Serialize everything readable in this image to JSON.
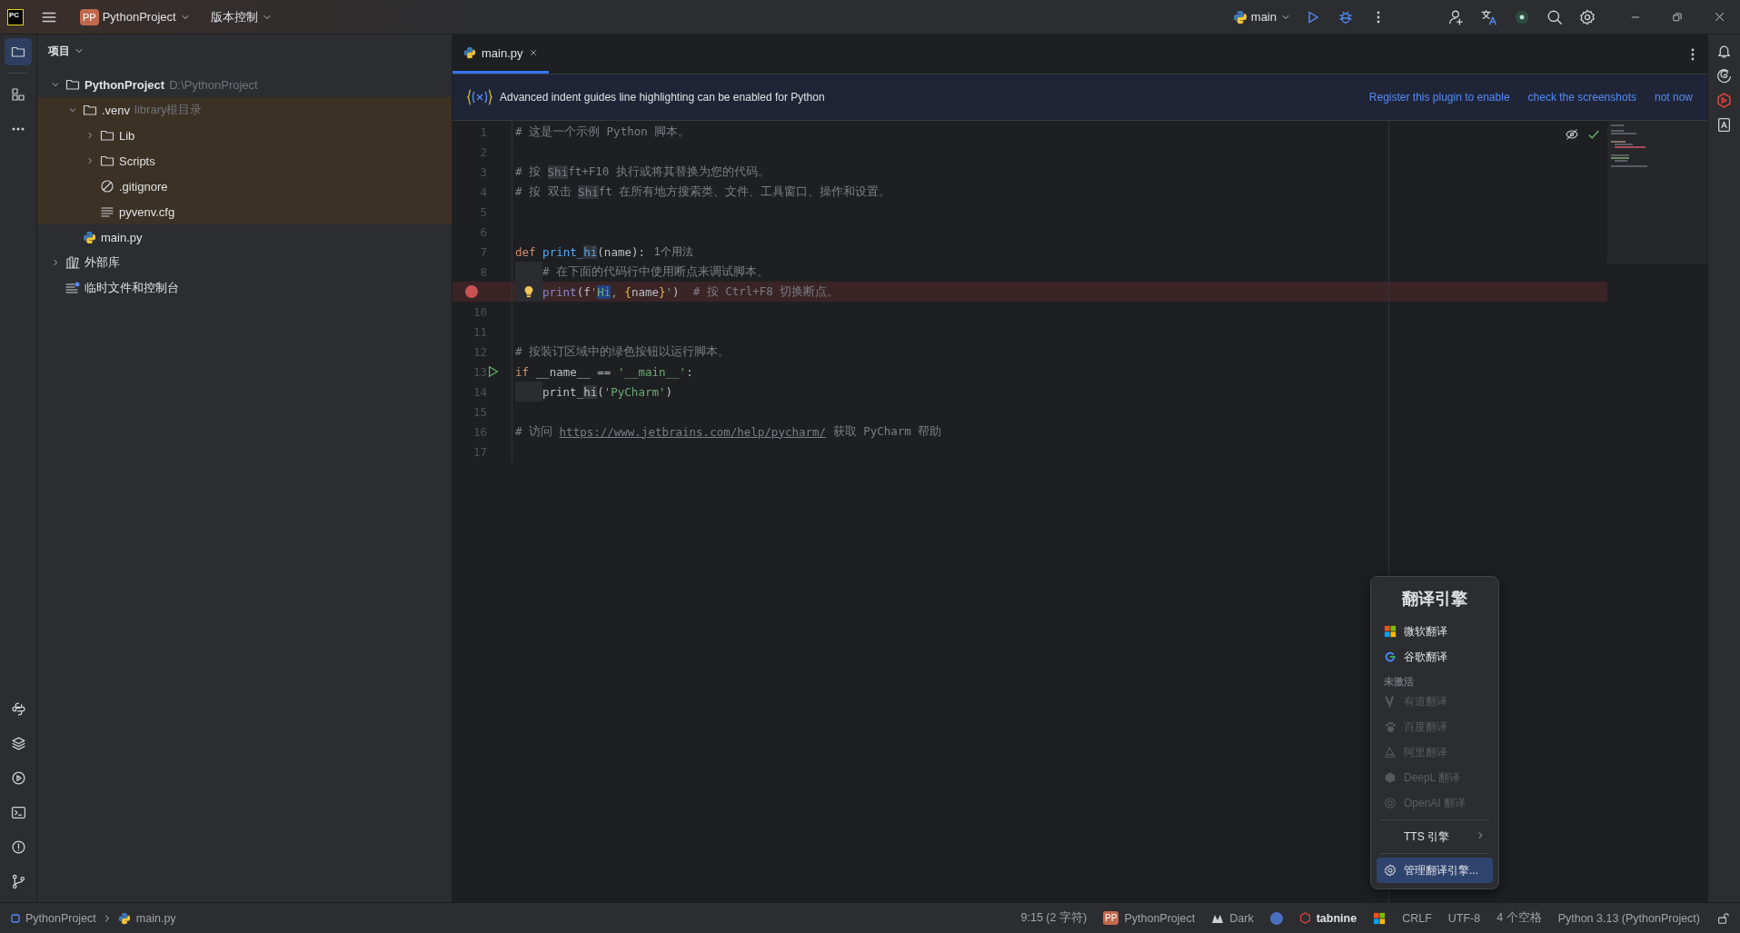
{
  "title_bar": {
    "logo": "PC",
    "project_badge": "PP",
    "project": "PythonProject",
    "vcs": "版本控制",
    "run_config": "main"
  },
  "tool_windows": [
    {
      "selected": true
    },
    {
      "selected": false
    }
  ],
  "project_panel": {
    "title": "项目",
    "tree": [
      {
        "name": "PythonProject",
        "note": "D:\\PythonProject",
        "kind": "folder",
        "bold": true,
        "expanded": true,
        "excluded": false,
        "children": [
          {
            "name": ".venv",
            "note": "library根目录",
            "kind": "folder",
            "bold": false,
            "expanded": true,
            "excluded": true,
            "children": [
              {
                "name": "Lib",
                "kind": "folder",
                "bold": false,
                "expanded": false
              },
              {
                "name": "Scripts",
                "kind": "folder",
                "bold": false,
                "expanded": false
              },
              {
                "name": ".gitignore",
                "kind": "ignore-file",
                "bold": false
              },
              {
                "name": "pyvenv.cfg",
                "kind": "text-file",
                "bold": false
              }
            ]
          },
          {
            "name": "main.py",
            "kind": "python-file",
            "bold": false,
            "excluded": false
          }
        ]
      },
      {
        "name": "外部库",
        "kind": "library",
        "bold": false,
        "expanded": false,
        "excluded": false
      },
      {
        "name": "临时文件和控制台",
        "kind": "scratches",
        "bold": false,
        "excluded": false
      }
    ]
  },
  "editor": {
    "tabs": [
      {
        "label": "main.py",
        "selected": true
      }
    ],
    "banner": {
      "text": "Advanced indent guides line highlighting can be enabled for Python",
      "links": [
        "Register this plugin to enable",
        "check the screenshots",
        "not now"
      ]
    },
    "lines": [
      {
        "number": "1",
        "tokens": [
          {
            "kind": "comment",
            "text": "# 这是一个示例 Python 脚本。"
          }
        ]
      },
      {
        "number": "2"
      },
      {
        "number": "3",
        "tokens": [
          {
            "kind": "comment",
            "text": "# 按 "
          },
          {
            "kind": "comment-match",
            "text": "Shi"
          },
          {
            "kind": "comment",
            "text": "ft+F10 执行或将其替换为您的代码。"
          }
        ]
      },
      {
        "number": "4",
        "tokens": [
          {
            "kind": "comment",
            "text": "# 按 双击 "
          },
          {
            "kind": "comment-match",
            "text": "Shi"
          },
          {
            "kind": "comment",
            "text": "ft 在所有地方搜索类、文件、工具窗口、操作和设置。"
          }
        ]
      },
      {
        "number": "5"
      },
      {
        "number": "6"
      },
      {
        "number": "7",
        "tokens": [
          {
            "kind": "keyword",
            "text": "def "
          },
          {
            "kind": "function",
            "text": "print_"
          },
          {
            "kind": "function-match",
            "text": "hi"
          },
          {
            "kind": "plain",
            "text": "(name):"
          },
          {
            "kind": "hint",
            "text": "1个用法"
          }
        ]
      },
      {
        "number": "8",
        "indent": true,
        "tokens": [
          {
            "kind": "comment",
            "text": "# 在下面的代码行中使用断点来调试脚本。"
          }
        ]
      },
      {
        "indent": true,
        "breakpoint": true,
        "intention": true,
        "tokens": [
          {
            "kind": "builtin",
            "text": "print"
          },
          {
            "kind": "plain",
            "text": "(f"
          },
          {
            "kind": "string",
            "text": "'"
          },
          {
            "kind": "string-selected",
            "text": "Hi"
          },
          {
            "kind": "string",
            "text": ", "
          },
          {
            "kind": "brace",
            "text": "{"
          },
          {
            "kind": "plain",
            "text": "name"
          },
          {
            "kind": "brace",
            "text": "}"
          },
          {
            "kind": "string",
            "text": "'"
          },
          {
            "kind": "plain",
            "text": ")  "
          },
          {
            "kind": "comment",
            "text": "# 按 Ctrl+F8 切换断点。"
          }
        ]
      },
      {
        "number": "10"
      },
      {
        "number": "11"
      },
      {
        "number": "12",
        "tokens": [
          {
            "kind": "comment",
            "text": "# 按装订区域中的绿色按钮以运行脚本。"
          }
        ]
      },
      {
        "number": "13",
        "run": true,
        "tokens": [
          {
            "kind": "keyword",
            "text": "if "
          },
          {
            "kind": "plain",
            "text": "__name__ == "
          },
          {
            "kind": "string",
            "text": "'__main__'"
          },
          {
            "kind": "plain",
            "text": ":"
          }
        ]
      },
      {
        "number": "14",
        "indent": true,
        "tokens": [
          {
            "kind": "plain",
            "text": "print_"
          },
          {
            "kind": "plain-match",
            "text": "hi"
          },
          {
            "kind": "plain",
            "text": "("
          },
          {
            "kind": "string",
            "text": "'PyCharm'"
          },
          {
            "kind": "plain",
            "text": ")"
          }
        ]
      },
      {
        "number": "15"
      },
      {
        "number": "16",
        "tokens": [
          {
            "kind": "comment",
            "text": "# 访问 "
          },
          {
            "kind": "link",
            "text": "https://www.jetbrains.com/help/pycharm/"
          },
          {
            "kind": "comment",
            "text": " 获取 PyCharm 帮助"
          }
        ]
      },
      {
        "number": "17"
      }
    ]
  },
  "translate_popup": {
    "title": "翻译引擎",
    "items": [
      {
        "kind": "engine",
        "label": "微软翻译",
        "disabled": false,
        "selected": false
      },
      {
        "kind": "engine",
        "label": "谷歌翻译",
        "disabled": false,
        "selected": false
      },
      {
        "kind": "section",
        "label": "未激活"
      },
      {
        "kind": "engine",
        "label": "有道翻译",
        "disabled": true,
        "selected": false
      },
      {
        "kind": "engine",
        "label": "百度翻译",
        "disabled": true,
        "selected": false
      },
      {
        "kind": "engine",
        "label": "阿里翻译",
        "disabled": true,
        "selected": false
      },
      {
        "kind": "engine",
        "label": "DeepL 翻译",
        "disabled": true,
        "selected": false
      },
      {
        "kind": "engine",
        "label": "OpenAI 翻译",
        "disabled": true,
        "selected": false
      },
      {
        "kind": "separator"
      },
      {
        "kind": "submenu",
        "label": "TTS 引擎",
        "disabled": false,
        "selected": false
      },
      {
        "kind": "separator"
      },
      {
        "kind": "action",
        "label": "管理翻译引擎...",
        "disabled": false,
        "selected": true
      }
    ]
  },
  "status_bar": {
    "breadcrumbs": [
      "PythonProject",
      "main.py"
    ],
    "position": "9:15 (2 字符)",
    "project_badge": "PP",
    "project": "PythonProject",
    "theme": "Dark",
    "tabnine": "tabnine",
    "line_separator": "CRLF",
    "encoding": "UTF-8",
    "indent": "4 个空格",
    "interpreter": "Python 3.13 (PythonProject)"
  }
}
